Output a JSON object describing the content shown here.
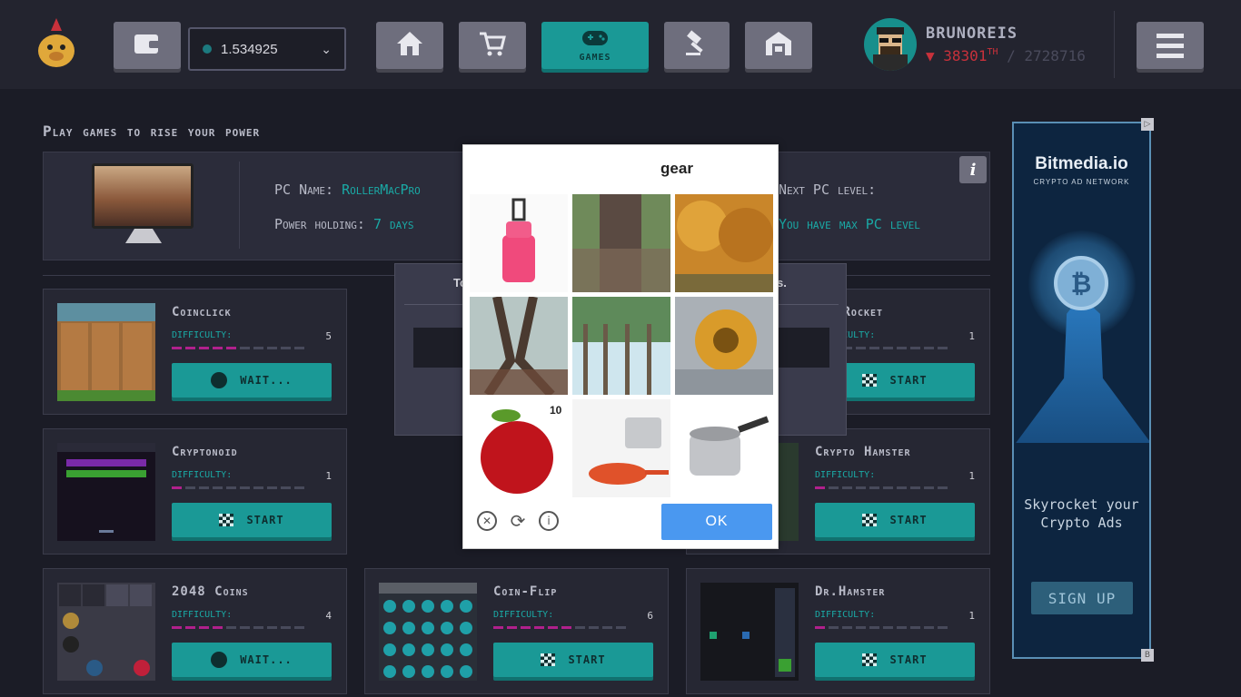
{
  "header": {
    "balance": "1.534925",
    "games_label": "GAMES",
    "username": "BRUNOREIS",
    "rank": "38301",
    "rank_suffix": "TH",
    "rank_total": "/ 2728716",
    "rank_direction": "down"
  },
  "page": {
    "heading": "Play games to rise your power"
  },
  "pc_panel": {
    "pc_name_label": "PC Name:",
    "pc_name_value": "RollerMacPro",
    "power_label": "Power holding:",
    "power_value": "7 days",
    "next_label": "Next PC level:",
    "next_value": "You have max PC level",
    "info_label": "i"
  },
  "games": [
    {
      "title": "Coinclick",
      "difficulty_label": "DIFFICULTY:",
      "difficulty": 5,
      "button": "WAIT..."
    },
    {
      "title": "Cryptonoid",
      "difficulty_label": "DIFFICULTY:",
      "difficulty": 1,
      "button": "START"
    },
    {
      "title": "2048 Coins",
      "difficulty_label": "DIFFICULTY:",
      "difficulty": 4,
      "button": "WAIT..."
    },
    {
      "title": "Coin-Flip",
      "difficulty_label": "DIFFICULTY:",
      "difficulty": 6,
      "button": "START"
    },
    {
      "title": "ppy Rocket",
      "difficulty_label": "DIFFICULTY:",
      "difficulty": 1,
      "button": "START"
    },
    {
      "title": "Crypto Hamster",
      "difficulty_label": "DIFFICULTY:",
      "difficulty": 1,
      "button": "START"
    },
    {
      "title": "Dr.Hamster",
      "difficulty_label": "DIFFICULTY:",
      "difficulty": 1,
      "button": "START"
    }
  ],
  "overlay": {
    "left_text": "To",
    "right_text": "s."
  },
  "captcha": {
    "prompt": "gear",
    "ok": "OK",
    "tiles": [
      "luggage",
      "tree-trunk",
      "autumn-trees",
      "tree-roots",
      "forest",
      "gear",
      "apple",
      "cookware",
      "saucepan"
    ]
  },
  "ad": {
    "logo": "Bitmedia.io",
    "sub": "CRYPTO AD NETWORK",
    "copy": "Skyrocket your Crypto Ads",
    "button": "SIGN UP",
    "corner_top": "▷",
    "corner_bottom": "B"
  },
  "colors": {
    "accent": "#1a9996",
    "difficulty_on": "#b0208c",
    "rank": "#c9313b",
    "ok_button": "#4a98f0"
  }
}
